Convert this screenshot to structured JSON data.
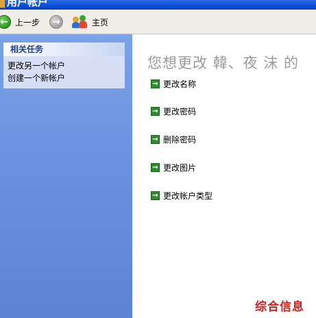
{
  "window": {
    "title": "用户帐户"
  },
  "toolbar": {
    "back_label": "上一步",
    "home_label": "主页"
  },
  "sidebar": {
    "panel_title": "相关任务",
    "links": [
      "更改另一个帐户",
      "创建一个新帐户"
    ]
  },
  "main": {
    "headline": "您想更改 韓、夜 沫 的",
    "actions": [
      "更改名称",
      "更改密码",
      "删除密码",
      "更改图片",
      "更改帐户类型"
    ]
  },
  "watermark": "综合信息"
}
